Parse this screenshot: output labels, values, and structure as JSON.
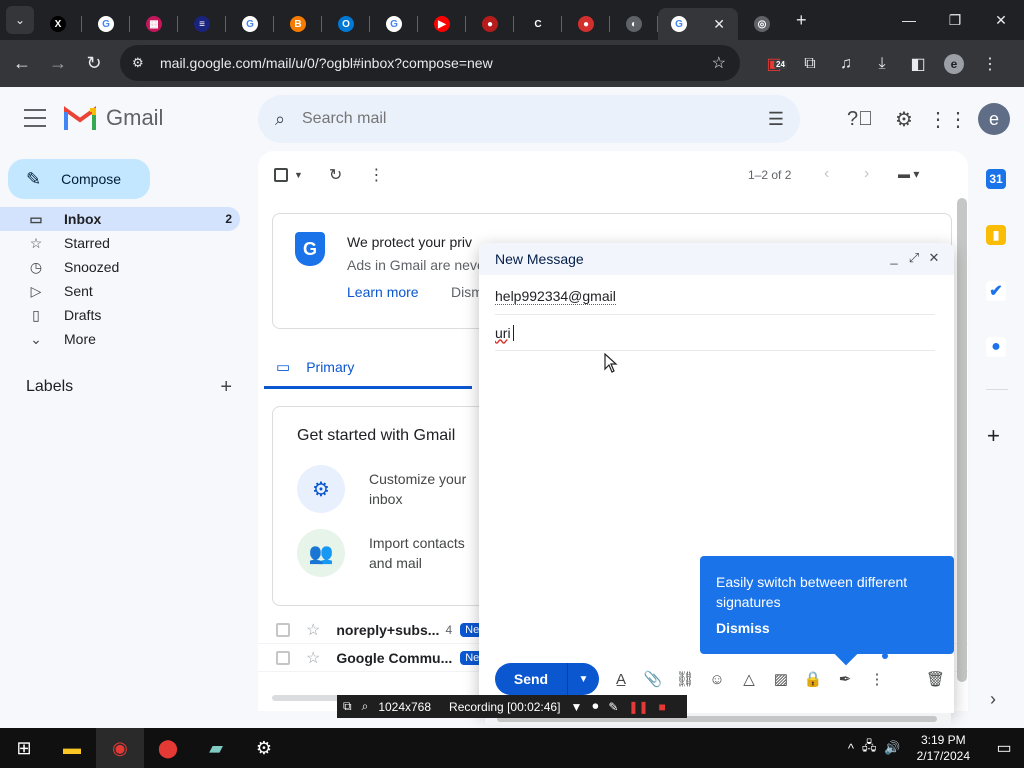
{
  "browser": {
    "tabs": [
      {
        "icon": "x-icon",
        "color": "#000000",
        "glyph": "X"
      },
      {
        "icon": "google-icon",
        "color": "#ffffff",
        "glyph": "G"
      },
      {
        "icon": "app-icon",
        "color": "#c2185b",
        "glyph": "▦"
      },
      {
        "icon": "app-icon",
        "color": "#1a237e",
        "glyph": "≡"
      },
      {
        "icon": "google-icon",
        "color": "#ffffff",
        "glyph": "G"
      },
      {
        "icon": "blogger-icon",
        "color": "#f57c00",
        "glyph": "B"
      },
      {
        "icon": "outlook-icon",
        "color": "#0078d4",
        "glyph": "O"
      },
      {
        "icon": "google-icon",
        "color": "#ffffff",
        "glyph": "G"
      },
      {
        "icon": "youtube-icon",
        "color": "#ff0000",
        "glyph": "▶"
      },
      {
        "icon": "record-icon",
        "color": "#b71c1c",
        "glyph": "●"
      },
      {
        "icon": "audio-icon",
        "color": "#202124",
        "glyph": "C"
      },
      {
        "icon": "record-icon",
        "color": "#d32f2f",
        "glyph": "●"
      },
      {
        "icon": "globe-icon",
        "color": "#5f6368",
        "glyph": "◐"
      }
    ],
    "url": "mail.google.com/mail/u/0/?ogbl#inbox?compose=new",
    "extension_badge": "24"
  },
  "gmail": {
    "brand": "Gmail",
    "search_placeholder": "Search mail",
    "account_initial": "e",
    "compose_label": "Compose",
    "nav": [
      {
        "label": "Inbox",
        "count": "2",
        "icon": "inbox-icon",
        "glyph": "▭"
      },
      {
        "label": "Starred",
        "count": "",
        "icon": "star-icon",
        "glyph": "☆"
      },
      {
        "label": "Snoozed",
        "count": "",
        "icon": "clock-icon",
        "glyph": "◷"
      },
      {
        "label": "Sent",
        "count": "",
        "icon": "send-icon",
        "glyph": "▷"
      },
      {
        "label": "Drafts",
        "count": "",
        "icon": "draft-icon",
        "glyph": "▯"
      },
      {
        "label": "More",
        "count": "",
        "icon": "chevron-down-icon",
        "glyph": "⌄"
      }
    ],
    "labels_title": "Labels",
    "pager": "1–2 of 2",
    "privacy": {
      "title": "We protect your priv",
      "text": "Ads in Gmail are neve",
      "learn_more": "Learn more",
      "dismiss": "Dism"
    },
    "tab_primary": "Primary",
    "get_started": {
      "title": "Get started with Gmail",
      "items": [
        {
          "label": "Customize your inbox",
          "icon": "settings-icon",
          "glyph": "⚙",
          "bg": "#e8f0fe",
          "fg": "#0b57d0"
        },
        {
          "label": "Import contacts and mail",
          "icon": "add-contact-icon",
          "glyph": "👥",
          "bg": "#e6f4ea",
          "fg": "#137333"
        }
      ]
    },
    "emails": [
      {
        "sender": "noreply+subs...",
        "count": "4",
        "badge": "Ne"
      },
      {
        "sender": "Google Commu...",
        "count": "",
        "badge": "Ne"
      }
    ]
  },
  "compose_window": {
    "title": "New Message",
    "to": "help992334@gmail",
    "subject_misspelled": "ur",
    "subject_rest": " i",
    "send_label": "Send",
    "tooltip_text": "Easily switch between different signatures",
    "tooltip_dismiss": "Dismiss"
  },
  "recording": {
    "resolution": "1024x768",
    "status": "Recording [00:02:46]"
  },
  "taskbar": {
    "time": "3:19 PM",
    "date": "2/17/2024"
  }
}
